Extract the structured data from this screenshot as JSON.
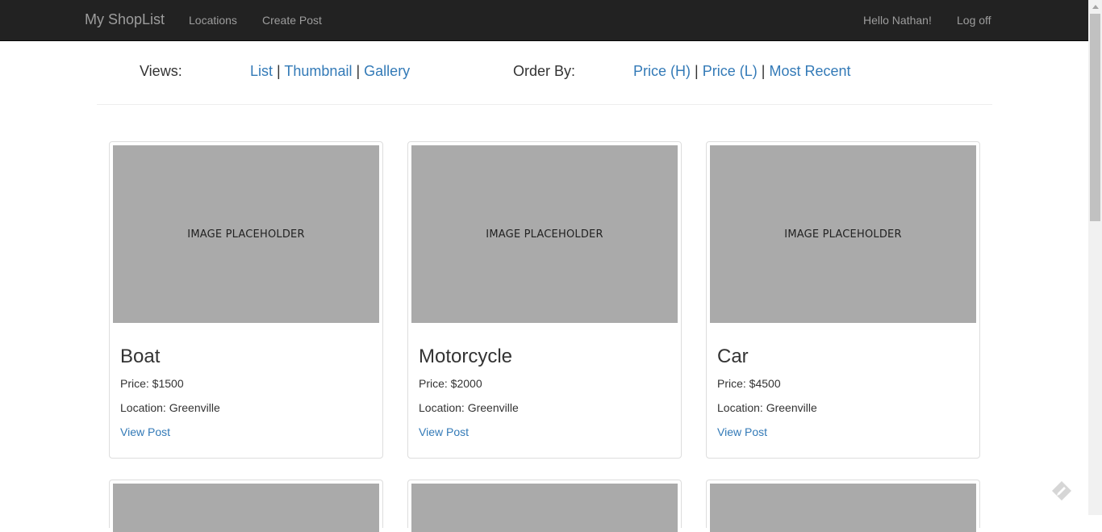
{
  "navbar": {
    "brand": "My ShopList",
    "links": [
      "Locations",
      "Create Post"
    ],
    "greeting": "Hello Nathan!",
    "logoff": "Log off"
  },
  "controls": {
    "views_label": "Views:",
    "views": [
      "List",
      "Thumbnail",
      "Gallery"
    ],
    "order_label": "Order By:",
    "order": [
      "Price (H)",
      "Price (L)",
      "Most Recent"
    ],
    "separator": "|"
  },
  "listings": [
    {
      "title": "Boat",
      "price": "Price: $1500",
      "location": "Location: Greenville",
      "image_text": "IMAGE PLACEHOLDER",
      "link": "View Post"
    },
    {
      "title": "Motorcycle",
      "price": "Price: $2000",
      "location": "Location: Greenville",
      "image_text": "IMAGE PLACEHOLDER",
      "link": "View Post"
    },
    {
      "title": "Car",
      "price": "Price: $4500",
      "location": "Location: Greenville",
      "image_text": "IMAGE PLACEHOLDER",
      "link": "View Post"
    }
  ],
  "colors": {
    "navbar_bg": "#222222",
    "nav_text": "#9d9d9d",
    "link": "#337ab7",
    "placeholder_bg": "#aaaaaa"
  },
  "icons": {
    "floating_action": "pencil-diamond-icon"
  }
}
